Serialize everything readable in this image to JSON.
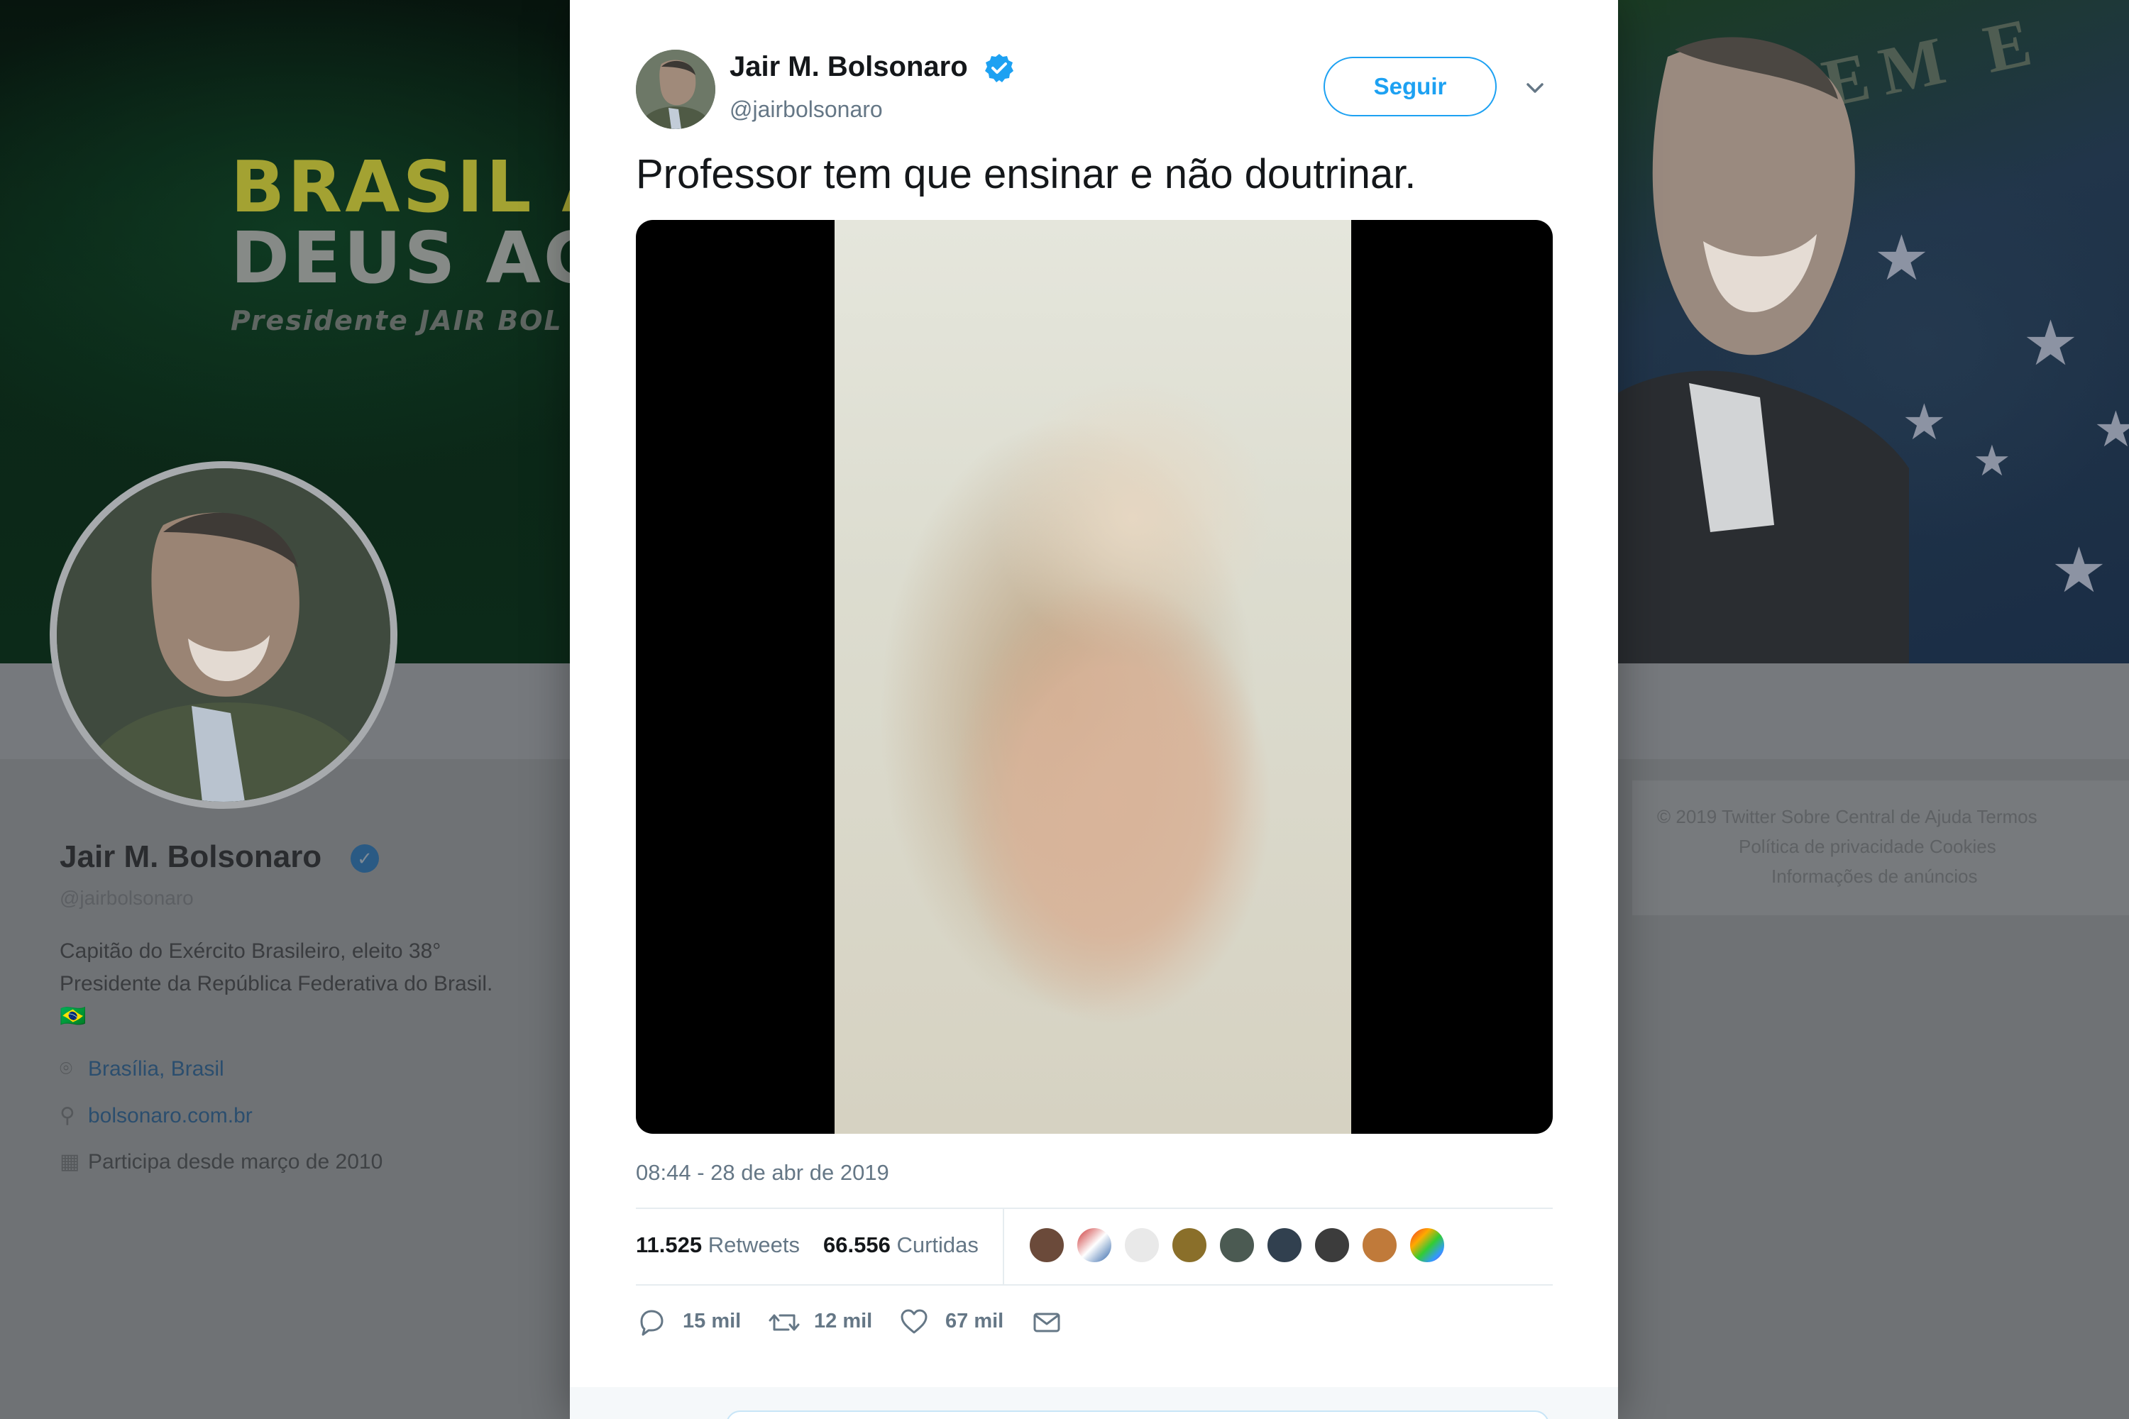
{
  "tweet": {
    "author_name": "Jair M. Bolsonaro",
    "author_handle": "@jairbolsonaro",
    "follow_label": "Seguir",
    "text": "Professor tem que ensinar e não doutrinar.",
    "timestamp": "08:44 - 28 de abr de 2019",
    "retweets_count": "11.525",
    "retweets_label": "Retweets",
    "likes_count": "66.556",
    "likes_label": "Curtidas",
    "actions": {
      "reply_count": "15 mil",
      "retweet_count": "12 mil",
      "like_count": "67 mil"
    },
    "liker_count": 9
  },
  "background_profile": {
    "banner_line1": "BRASIL A",
    "banner_line2": "DEUS AC",
    "banner_line3": "Presidente JAIR BOL",
    "flag_motto": "REM E",
    "name": "Jair M. Bolsonaro",
    "handle": "@jairbolsonaro",
    "bio": "Capitão do Exército Brasileiro, eleito 38° Presidente da República Federativa do Brasil. 🇧🇷",
    "location": "Brasília, Brasil",
    "website": "bolsonaro.com.br",
    "joined": "Participa desde março de 2010",
    "footer_line1": "© 2019 Twitter   Sobre   Central de Ajuda   Termos",
    "footer_line2": "Política de privacidade   Cookies",
    "footer_line3": "Informações de anúncios"
  },
  "colors": {
    "twitter_blue": "#1da1f2",
    "text_primary": "#14171a",
    "text_secondary": "#657786",
    "divider": "#e6ecf0"
  },
  "icons": {
    "verified": "verified-badge-icon",
    "caret": "chevron-down-icon",
    "reply": "reply-icon",
    "retweet": "retweet-icon",
    "like": "heart-icon",
    "dm": "envelope-icon",
    "location": "location-pin-icon",
    "link": "link-icon",
    "calendar": "calendar-icon"
  }
}
